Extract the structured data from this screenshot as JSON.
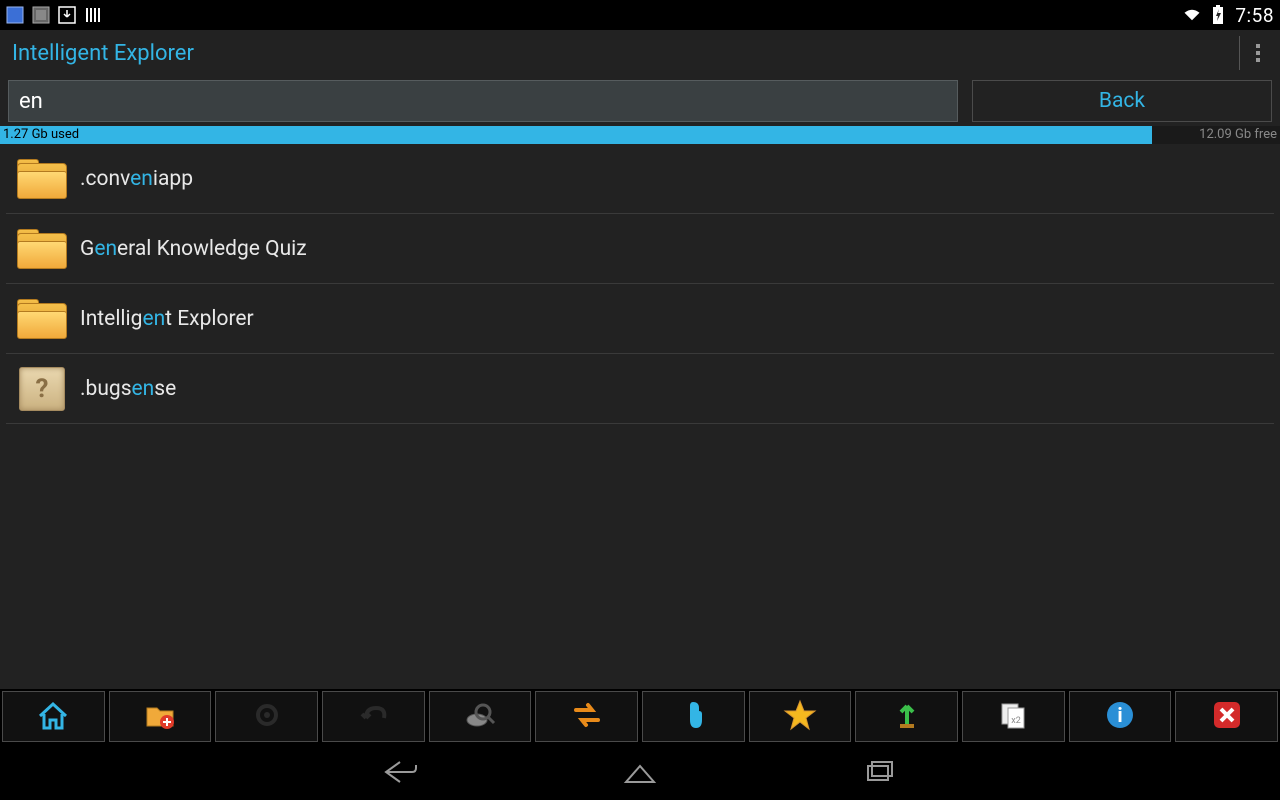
{
  "status": {
    "time": "7:58",
    "icons_left": [
      "app1",
      "app2",
      "download",
      "barcode"
    ],
    "icons_right": [
      "wifi",
      "battery-charging"
    ]
  },
  "titlebar": {
    "title": "Intelligent Explorer"
  },
  "search": {
    "query": "en",
    "back_label": "Back"
  },
  "storage": {
    "used_label": "1.27 Gb used",
    "free_label": "12.09 Gb free",
    "used_pct": 90
  },
  "files": [
    {
      "icon": "folder",
      "name": ".conveniapp",
      "match": "en"
    },
    {
      "icon": "folder",
      "name": "General Knowledge Quiz",
      "match": "en"
    },
    {
      "icon": "folder",
      "name": "Intelligent Explorer",
      "match": "en"
    },
    {
      "icon": "box",
      "name": ".bugsense",
      "match": "en"
    }
  ],
  "toolbar": {
    "items": [
      {
        "name": "home",
        "color": "#33b5e5"
      },
      {
        "name": "new-folder"
      },
      {
        "name": "settings-dark"
      },
      {
        "name": "undo-dark"
      },
      {
        "name": "search-disk"
      },
      {
        "name": "swap"
      },
      {
        "name": "touch"
      },
      {
        "name": "favorite"
      },
      {
        "name": "upload"
      },
      {
        "name": "copy"
      },
      {
        "name": "info"
      },
      {
        "name": "close"
      }
    ]
  },
  "nav": {
    "items": [
      "back",
      "home",
      "recents"
    ]
  }
}
